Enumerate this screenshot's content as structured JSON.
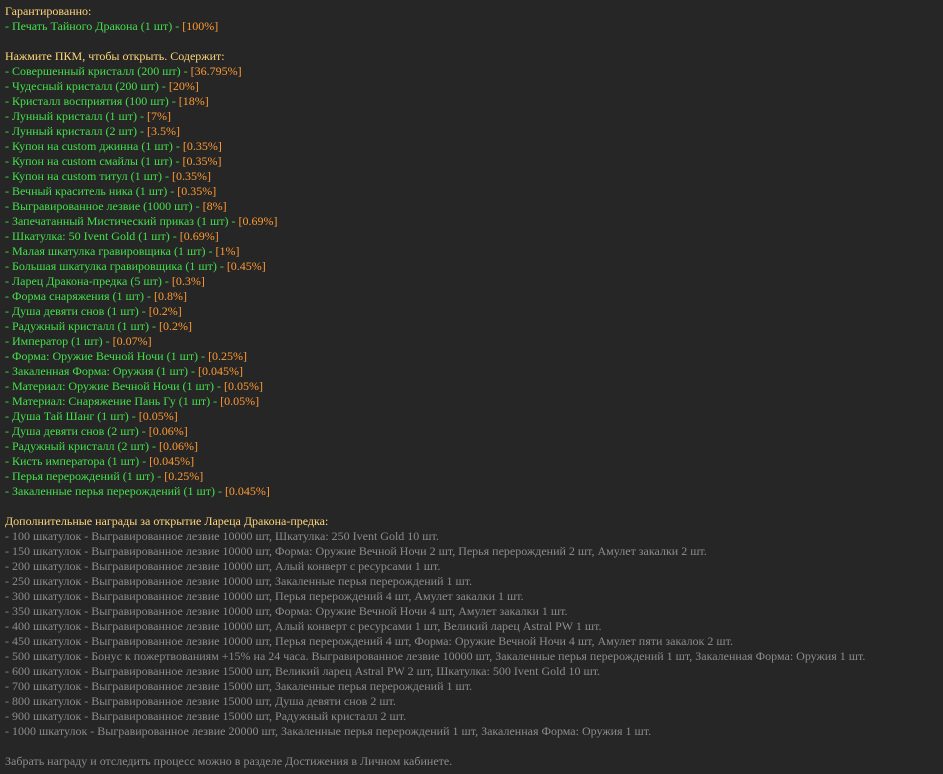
{
  "colors": {
    "background": "#262626",
    "header": "#ffd67a",
    "item": "#43e04b",
    "chance": "#ff9a33",
    "muted": "#8c8c8c"
  },
  "guaranteed": {
    "header": "Гарантированно:",
    "items": [
      {
        "name": "- Печать Тайного Дракона (1 шт) - ",
        "chance": "[100%]"
      }
    ]
  },
  "contents": {
    "header": "Нажмите ПКМ, чтобы открыть. Содержит:",
    "items": [
      {
        "name": "- Совершенный кристалл (200 шт) - ",
        "chance": "[36.795%]"
      },
      {
        "name": "- Чудесный кристалл (200 шт) - ",
        "chance": "[20%]"
      },
      {
        "name": "- Кристалл восприятия (100 шт) - ",
        "chance": "[18%]"
      },
      {
        "name": "- Лунный кристалл (1 шт) - ",
        "chance": "[7%]"
      },
      {
        "name": "- Лунный кристалл (2 шт) - ",
        "chance": "[3.5%]"
      },
      {
        "name": "- Купон на custom джинна (1 шт) - ",
        "chance": "[0.35%]"
      },
      {
        "name": "- Купон на custom смайлы  (1 шт) - ",
        "chance": "[0.35%]"
      },
      {
        "name": "- Купон на custom титул  (1 шт) - ",
        "chance": "[0.35%]"
      },
      {
        "name": "- Вечный краситель ника (1 шт) - ",
        "chance": "[0.35%]"
      },
      {
        "name": "- Выгравированное лезвие (1000 шт) - ",
        "chance": "[8%]"
      },
      {
        "name": "- Запечатанный Мистический приказ (1 шт) - ",
        "chance": "[0.69%]"
      },
      {
        "name": "- Шкатулка: 50 Ivent Gold (1 шт) - ",
        "chance": "[0.69%]"
      },
      {
        "name": "- Малая шкатулка гравировщика (1 шт) - ",
        "chance": "[1%]"
      },
      {
        "name": "- Большая шкатулка гравировщика (1 шт) - ",
        "chance": "[0.45%]"
      },
      {
        "name": "- Ларец Дракона-предка (5 шт) - ",
        "chance": "[0.3%]"
      },
      {
        "name": "- Форма снаряжения (1 шт) - ",
        "chance": "[0.8%]"
      },
      {
        "name": "- Душа девяти снов (1 шт) - ",
        "chance": "[0.2%]"
      },
      {
        "name": "- Радужный кристалл (1 шт) - ",
        "chance": "[0.2%]"
      },
      {
        "name": "- Император (1 шт) - ",
        "chance": "[0.07%]"
      },
      {
        "name": "- Форма: Оружие Вечной Ночи (1 шт) - ",
        "chance": "[0.25%]"
      },
      {
        "name": "- Закаленная Форма: Оружия (1 шт) - ",
        "chance": "[0.045%]"
      },
      {
        "name": "- Материал: Оружие Вечной Ночи (1 шт) - ",
        "chance": "[0.05%]"
      },
      {
        "name": "- Материал: Снаряжение Пань Гу (1 шт) - ",
        "chance": "[0.05%]"
      },
      {
        "name": "- Душа Тай Шанг (1 шт) - ",
        "chance": "[0.05%]"
      },
      {
        "name": "- Душа девяти снов (2 шт) - ",
        "chance": "[0.06%]"
      },
      {
        "name": "- Радужный кристалл (2 шт) - ",
        "chance": "[0.06%]"
      },
      {
        "name": "- Кисть императора (1 шт) - ",
        "chance": "[0.045%]"
      },
      {
        "name": "- Перья перерождений (1 шт) - ",
        "chance": "[0.25%]"
      },
      {
        "name": "- Закаленные перья перерождений (1 шт) - ",
        "chance": "[0.045%]"
      }
    ]
  },
  "extra_rewards": {
    "header": "Дополнительные награды за открытие Лареца Дракона-предка:",
    "items": [
      "- 100 шкатулок - Выгравированное лезвие 10000 шт, Шкатулка: 250 Ivent Gold 10 шт.",
      "- 150 шкатулок - Выгравированное лезвие 10000 шт, Форма: Оружие Вечной Ночи 2 шт, Перья перерождений 2 шт, Амулет закалки 2 шт.",
      "- 200 шкатулок - Выгравированное лезвие 10000 шт, Алый конверт с ресурсами 1 шт.",
      "- 250 шкатулок - Выгравированное лезвие 10000 шт, Закаленные перья перерождений 1 шт.",
      "- 300 шкатулок - Выгравированное лезвие 10000 шт, Перья перерождений 4 шт, Амулет закалки 1 шт.",
      "- 350 шкатулок - Выгравированное лезвие 10000 шт, Форма: Оружие Вечной Ночи 4 шт, Амулет закалки 1 шт.",
      "- 400 шкатулок - Выгравированное лезвие 10000 шт, Алый конверт с ресурсами 1 шт, Великий ларец Astral PW 1 шт.",
      "- 450 шкатулок - Выгравированное лезвие 10000 шт, Перья перерождений 4 шт, Форма: Оружие Вечной Ночи 4 шт, Амулет пяти закалок 2 шт.",
      "- 500 шкатулок - Бонус к пожертвованиям +15% на 24 часа. Выгравированное лезвие 10000 шт, Закаленные перья перерождений 1 шт, Закаленная Форма: Оружия 1 шт.",
      "- 600 шкатулок - Выгравированное лезвие 15000 шт, Великий ларец Astral PW 2 шт, Шкатулка: 500 Ivent Gold 10 шт.",
      "- 700 шкатулок - Выгравированное лезвие 15000 шт, Закаленные перья перерождений 1 шт.",
      "- 800 шкатулок - Выгравированное лезвие 15000 шт, Душа девяти снов 2 шт.",
      "- 900 шкатулок - Выгравированное лезвие 15000 шт, Радужный кристалл 2 шт.",
      "- 1000 шкатулок - Выгравированное лезвие 20000 шт, Закаленные перья перерождений 1 шт, Закаленная Форма: Оружия 1 шт."
    ]
  },
  "footer": {
    "text": "Забрать награду и отследить процесс можно в разделе Достижения в Личном кабинете."
  }
}
